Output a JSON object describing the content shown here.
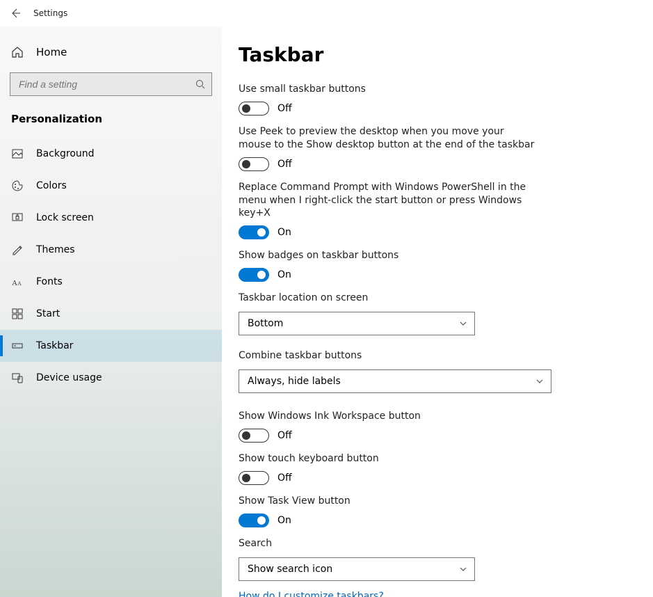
{
  "titlebar": {
    "title": "Settings"
  },
  "sidebar": {
    "home_label": "Home",
    "search_placeholder": "Find a setting",
    "category": "Personalization",
    "items": [
      {
        "label": "Background"
      },
      {
        "label": "Colors"
      },
      {
        "label": "Lock screen"
      },
      {
        "label": "Themes"
      },
      {
        "label": "Fonts"
      },
      {
        "label": "Start"
      },
      {
        "label": "Taskbar"
      },
      {
        "label": "Device usage"
      }
    ]
  },
  "main": {
    "heading": "Taskbar",
    "settings": {
      "small_buttons": {
        "label": "Use small taskbar buttons",
        "value": false,
        "state": "Off"
      },
      "peek": {
        "label": "Use Peek to preview the desktop when you move your mouse to the Show desktop button at the end of the taskbar",
        "value": false,
        "state": "Off"
      },
      "powershell": {
        "label": "Replace Command Prompt with Windows PowerShell in the menu when I right-click the start button or press Windows key+X",
        "value": true,
        "state": "On"
      },
      "badges": {
        "label": "Show badges on taskbar buttons",
        "value": true,
        "state": "On"
      },
      "location": {
        "label": "Taskbar location on screen",
        "value": "Bottom"
      },
      "combine": {
        "label": "Combine taskbar buttons",
        "value": "Always, hide labels"
      },
      "ink": {
        "label": "Show Windows Ink Workspace button",
        "value": false,
        "state": "Off"
      },
      "touch_kb": {
        "label": "Show touch keyboard button",
        "value": false,
        "state": "Off"
      },
      "task_view": {
        "label": "Show Task View button",
        "value": true,
        "state": "On"
      },
      "search": {
        "label": "Search",
        "value": "Show search icon"
      }
    },
    "help_link": "How do I customize taskbars?"
  }
}
